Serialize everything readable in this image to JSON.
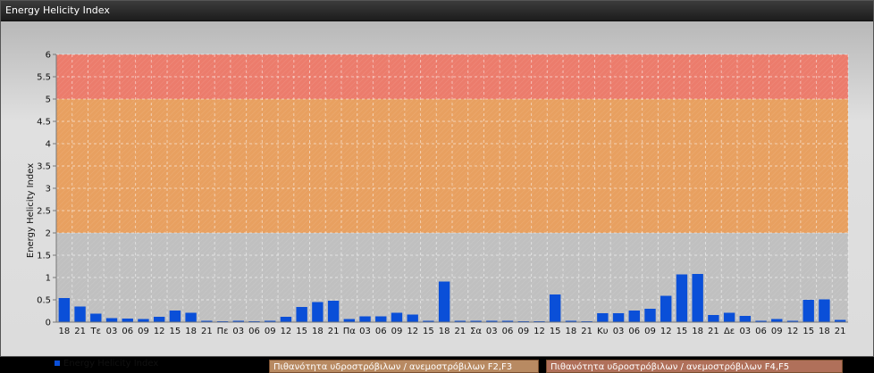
{
  "window": {
    "title": "Energy Helicity Index"
  },
  "legend": {
    "series_label": "Energy Helicity Index",
    "zone_f2f3": "Πιθανότητα υδροστρόβιλων / ανεμοστρόβιλων F2,F3",
    "zone_f4f5": "Πιθανότητα υδροστρόβιλων / ανεμοστρόβιλων F4,F5"
  },
  "colors": {
    "bar": "#0a4fd8",
    "zone_low": "#c0c0c0",
    "zone_mid": "#e8a060",
    "zone_high": "#ec7c6c"
  },
  "chart_data": {
    "type": "bar",
    "title": "",
    "xlabel": "",
    "ylabel": "Energy Helicity Index",
    "ylim": [
      0,
      6
    ],
    "yticks": [
      "0",
      "0.5",
      "1",
      "1.5",
      "2",
      "2.5",
      "3",
      "3.5",
      "4",
      "4.5",
      "5",
      "5.5",
      "6"
    ],
    "grid": true,
    "legend_position": "bottom-left",
    "zones": [
      {
        "from": 0,
        "to": 2,
        "color": "#c0c0c0"
      },
      {
        "from": 2,
        "to": 5,
        "color": "#e8a060"
      },
      {
        "from": 5,
        "to": 6,
        "color": "#ec7c6c"
      }
    ],
    "categories": [
      "18",
      "21",
      "Τε",
      "03",
      "06",
      "09",
      "12",
      "15",
      "18",
      "21",
      "Πε",
      "03",
      "06",
      "09",
      "12",
      "15",
      "18",
      "21",
      "Πα",
      "03",
      "06",
      "09",
      "12",
      "15",
      "18",
      "21",
      "Σα",
      "03",
      "06",
      "09",
      "12",
      "15",
      "18",
      "21",
      "Κυ",
      "03",
      "06",
      "09",
      "12",
      "15",
      "18",
      "21",
      "Δε",
      "03",
      "06",
      "09",
      "12",
      "15",
      "18",
      "21"
    ],
    "series": [
      {
        "name": "Energy Helicity Index",
        "values": [
          0.54,
          0.35,
          0.19,
          0.09,
          0.08,
          0.07,
          0.12,
          0.26,
          0.21,
          0.03,
          0.02,
          0.03,
          0.02,
          0.03,
          0.12,
          0.34,
          0.45,
          0.48,
          0.07,
          0.13,
          0.13,
          0.21,
          0.17,
          0.03,
          0.91,
          0.03,
          0.03,
          0.03,
          0.03,
          0.02,
          0.02,
          0.62,
          0.03,
          0.02,
          0.2,
          0.2,
          0.26,
          0.3,
          0.59,
          1.07,
          1.08,
          0.16,
          0.21,
          0.14,
          0.03,
          0.07,
          0.03,
          0.5,
          0.51,
          0.05
        ]
      }
    ]
  }
}
